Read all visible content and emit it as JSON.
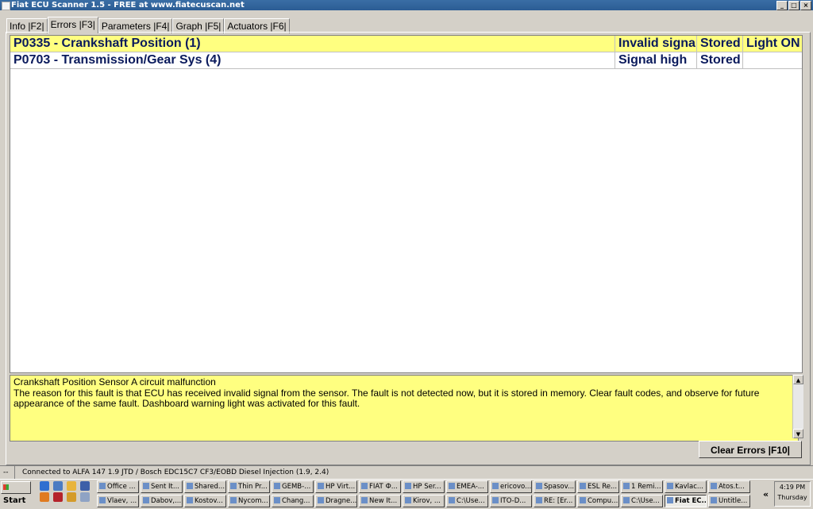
{
  "window": {
    "title": "Fiat ECU Scanner 1.5 - FREE at www.fiatecuscan.net"
  },
  "tabs": [
    {
      "label": "Info |F2|"
    },
    {
      "label": "Errors |F3|"
    },
    {
      "label": "Parameters |F4|"
    },
    {
      "label": "Graph |F5|"
    },
    {
      "label": "Actuators |F6|"
    }
  ],
  "errors": [
    {
      "code": "P0335 - Crankshaft Position (1)",
      "type": "Invalid signal",
      "state": "Stored",
      "light": "Light ON"
    },
    {
      "code": "P0703 - Transmission/Gear Sys (4)",
      "type": "Signal high",
      "state": "Stored",
      "light": ""
    }
  ],
  "description": {
    "title": "Crankshaft Position Sensor A circuit malfunction",
    "text": "The reason for this fault is that ECU has received invalid signal from the sensor. The fault is not detected now, but it is stored in memory. Clear fault codes, and observe for future appearance of the same fault. Dashboard warning light was activated for this fault."
  },
  "buttons": {
    "clear_errors": "Clear Errors |F10|"
  },
  "status": {
    "left": "--",
    "connection": "Connected to ALFA 147 1.9 JTD / Bosch EDC15C7 CF3/EOBD Diesel Injection (1.9, 2.4)"
  },
  "taskbar": {
    "start": "Start",
    "tasks": [
      "Office ...",
      "Sent It...",
      "Shared...",
      "Thin Pr...",
      "GEMB-...",
      "HP Virt...",
      "FIAT Ф...",
      "HP Ser...",
      "EMEA-...",
      "ericovo...",
      "Spasov...",
      "ESL Re...",
      "1 Remi...",
      "Kavlac...",
      "Atos.t...",
      "Vlaev, ...",
      "Dabov,...",
      "Kostov...",
      "Nycom...",
      "Chang...",
      "Dragne...",
      "New It...",
      "Kirov, ...",
      "C:\\Use...",
      "ITO-D...",
      "RE: [Er...",
      "Compu...",
      "C:\\Use...",
      "Fiat EC...",
      "Untitle..."
    ],
    "active_task": "Fiat EC...",
    "chevron": "«",
    "clock": "4:19 PM",
    "day": "Thursday"
  },
  "colors": {
    "highlight": "#ffff80",
    "text_blue": "#0a1a5c",
    "title_bar": "#3a6ea5"
  }
}
